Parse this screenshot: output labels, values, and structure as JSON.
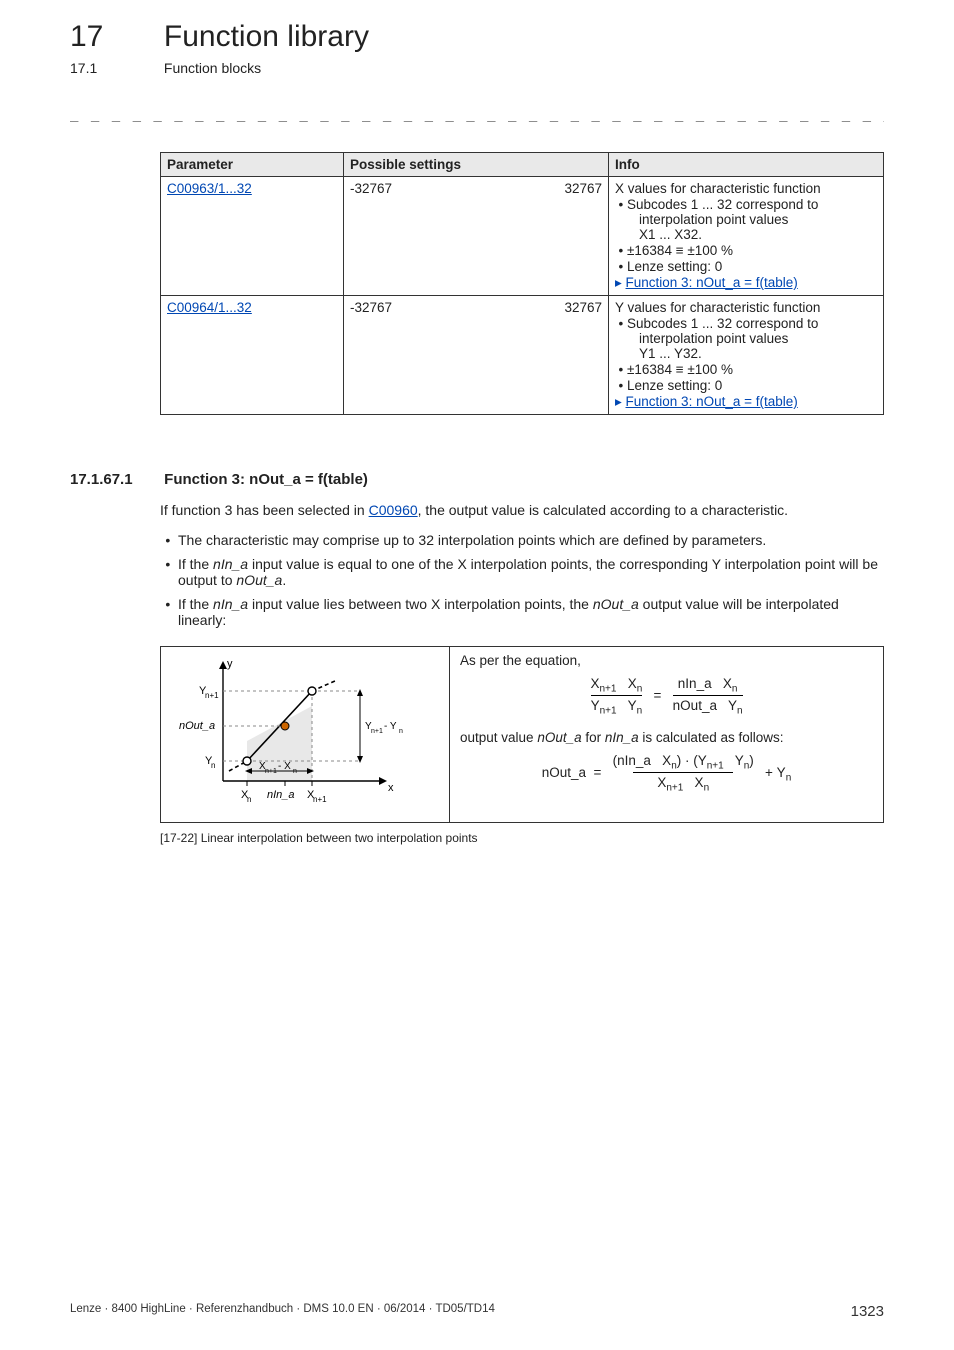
{
  "chapter": {
    "num": "17",
    "title": "Function library"
  },
  "section": {
    "num": "17.1",
    "title": "Function blocks"
  },
  "table": {
    "headers": {
      "param": "Parameter",
      "ps": "Possible settings",
      "info": "Info"
    },
    "rows": [
      {
        "param": "C00963/1...32",
        "min": "-32767",
        "max": "32767",
        "info_line1": "X values for characteristic function",
        "info_b1": "Subcodes 1 ... 32 correspond to",
        "info_b1s": "interpolation point values",
        "info_b1s2": "X1 ... X32.",
        "info_b2": "±16384 ≡ ±100 %",
        "info_b3": "Lenze setting: 0",
        "info_link": "Function 3: nOut_a = f(table)"
      },
      {
        "param": "C00964/1...32",
        "min": "-32767",
        "max": "32767",
        "info_line1": "Y values for characteristic function",
        "info_b1": "Subcodes 1 ... 32 correspond to",
        "info_b1s": "interpolation point values",
        "info_b1s2": "Y1 ... Y32.",
        "info_b2": "±16384 ≡ ±100 %",
        "info_b3": "Lenze setting: 0",
        "info_link": "Function 3: nOut_a = f(table)"
      }
    ]
  },
  "subsection": {
    "num": "17.1.67.1",
    "title": "Function 3: nOut_a = f(table)",
    "intro_a": "If function 3 has been selected in ",
    "intro_link": "C00960",
    "intro_b": ", the output value is calculated according to a characteristic.",
    "bul1": "The characteristic may comprise up to 32 interpolation points which are defined by parameters.",
    "bul2a": "If the ",
    "bul2_it1": "nIn_a",
    "bul2b": " input value is equal to one of the X interpolation points, the corresponding Y interpolation point will be output to ",
    "bul2_it2": "nOut_a",
    "bul2c": ".",
    "bul3a": "If the ",
    "bul3_it1": "nIn_a",
    "bul3b": " input value lies between two X interpolation points, the ",
    "bul3_it2": "nOut_a",
    "bul3c": " output value will be interpolated linearly:"
  },
  "figure": {
    "asper": "As per the equation,",
    "outline_a": "output value ",
    "outline_it1": "nOut_a",
    "outline_b": " for ",
    "outline_it2": "nIn_a",
    "outline_c": " is calculated as follows:",
    "caption": "[17-22]  Linear interpolation between two interpolation points",
    "axis": {
      "y": "y",
      "x": "x",
      "Yn1": "Y",
      "Yn": "Y",
      "nOut": "nOut_a",
      "Xn": "X",
      "nIn": "nIn_a",
      "Xn1": "X",
      "dy": "Y       - Y",
      "dx": "X      - X"
    }
  },
  "footer": {
    "left": "Lenze · 8400 HighLine · Referenzhandbuch · DMS 10.0 EN · 06/2014 · TD05/TD14",
    "page": "1323"
  }
}
